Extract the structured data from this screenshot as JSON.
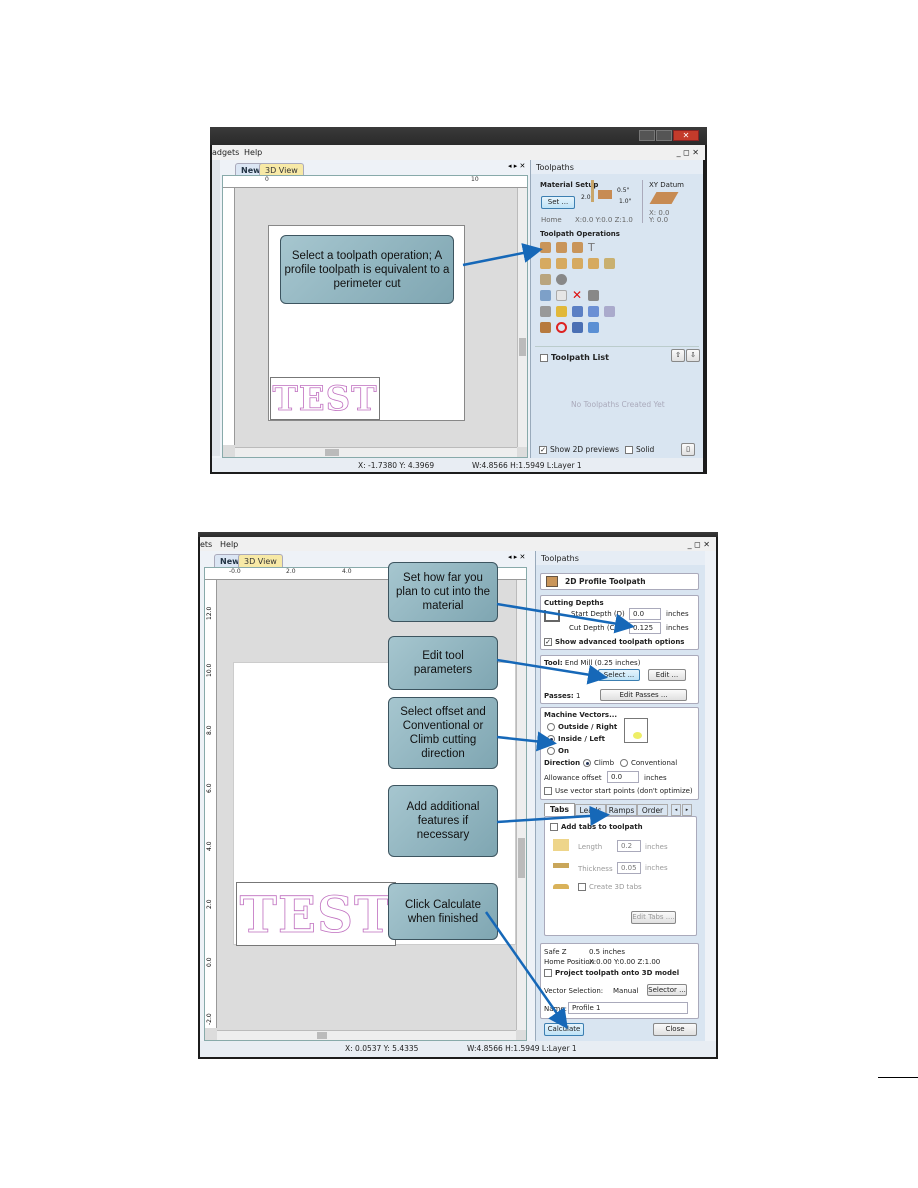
{
  "shot1": {
    "menu": [
      "adgets",
      "Help"
    ],
    "tabs": [
      "New",
      "3D View"
    ],
    "ruler_top": [
      "0",
      "10"
    ],
    "test_text": "TEST",
    "callout": "Select a toolpath operation; A profile toolpath is equivalent to a perimeter cut",
    "status": {
      "coords": "X: -1.7380 Y:  4.3969",
      "size": "W:4.8566   H:1.5949   L:Layer 1"
    },
    "panel": {
      "title": "Toolpaths",
      "material_setup": "Material Setup",
      "set_button": "Set ...",
      "dim_top": "0.5\"",
      "dim_side": "2.0",
      "dim_bottom": "1.0\"",
      "xy_datum": "XY Datum",
      "xy_values": [
        "X: 0.0",
        "Y: 0.0"
      ],
      "home_label": "Home",
      "home_values": "X:0.0 Y:0.0 Z:1.0",
      "operations_heading": "Toolpath Operations",
      "toolpath_list": "Toolpath List",
      "empty_message": "No Toolpaths Created Yet",
      "show_2d": "Show 2D previews",
      "show_2d_checked": true,
      "solid": "Solid",
      "solid_checked": false
    }
  },
  "shot2": {
    "menu": [
      "ets",
      "Help"
    ],
    "tabs": [
      "New",
      "3D View"
    ],
    "ruler_top": [
      "-0.0",
      "2.0",
      "4.0"
    ],
    "ruler_left": [
      "12.0",
      "10.0",
      "8.0",
      "6.0",
      "4.0",
      "2.0",
      "0.0",
      "-2.0"
    ],
    "test_text": "TEST",
    "callouts": [
      "Set how far you plan to cut into the material",
      "Edit tool parameters",
      "Select offset and Conventional or Climb cutting direction",
      "Add additional features if necessary",
      "Click Calculate when finished"
    ],
    "status": {
      "coords": "X:  0.0537 Y:  5.4335",
      "size": "W:4.8566   H:1.5949   L:Layer 1"
    },
    "panel": {
      "title": "Toolpaths",
      "heading": "2D Profile Toolpath",
      "cutting_depths": "Cutting Depths",
      "start_depth_label": "Start Depth (D)",
      "start_depth": "0.0",
      "cut_depth_label": "Cut Depth (C)",
      "cut_depth": "0.125",
      "units": "inches",
      "show_advanced": "Show advanced toolpath options",
      "tool_label": "Tool:",
      "tool_value": "End Mill (0.25 inches)",
      "select_button": "Select ...",
      "edit_button": "Edit ...",
      "passes_label": "Passes:",
      "passes_value": "1",
      "edit_passes_button": "Edit Passes ...",
      "machine_vectors": "Machine Vectors...",
      "offset_options": [
        "Outside / Right",
        "Inside / Left",
        "On"
      ],
      "offset_selected": "Inside / Left",
      "direction_label": "Direction",
      "direction_options": [
        "Climb",
        "Conventional"
      ],
      "direction_selected": "Climb",
      "allowance_label": "Allowance offset",
      "allowance_value": "0.0",
      "use_vector_start": "Use vector start points (don't optimize)",
      "tabs": [
        "Tabs",
        "Leads",
        "Ramps",
        "Order"
      ],
      "active_tab": "Tabs",
      "add_tabs": "Add tabs to toolpath",
      "length_label": "Length",
      "length_value": "0.2",
      "thickness_label": "Thickness",
      "thickness_value": "0.05",
      "create_3d_tabs": "Create 3D tabs",
      "edit_tabs_button": "Edit Tabs ....",
      "safe_z_label": "Safe Z",
      "safe_z_value": "0.5 inches",
      "home_label": "Home Position",
      "home_value": "X:0.00 Y:0.00 Z:1.00",
      "project": "Project toolpath onto 3D model",
      "vector_selection_label": "Vector Selection:",
      "vector_selection_value": "Manual",
      "selector_button": "Selector ...",
      "name_label": "Name:",
      "name_value": "Profile 1",
      "calculate_button": "Calculate",
      "close_button": "Close"
    }
  },
  "colors": {
    "callout": "#8fb4bf",
    "arrow": "#1668b8",
    "test_outline": "#c070c0"
  }
}
